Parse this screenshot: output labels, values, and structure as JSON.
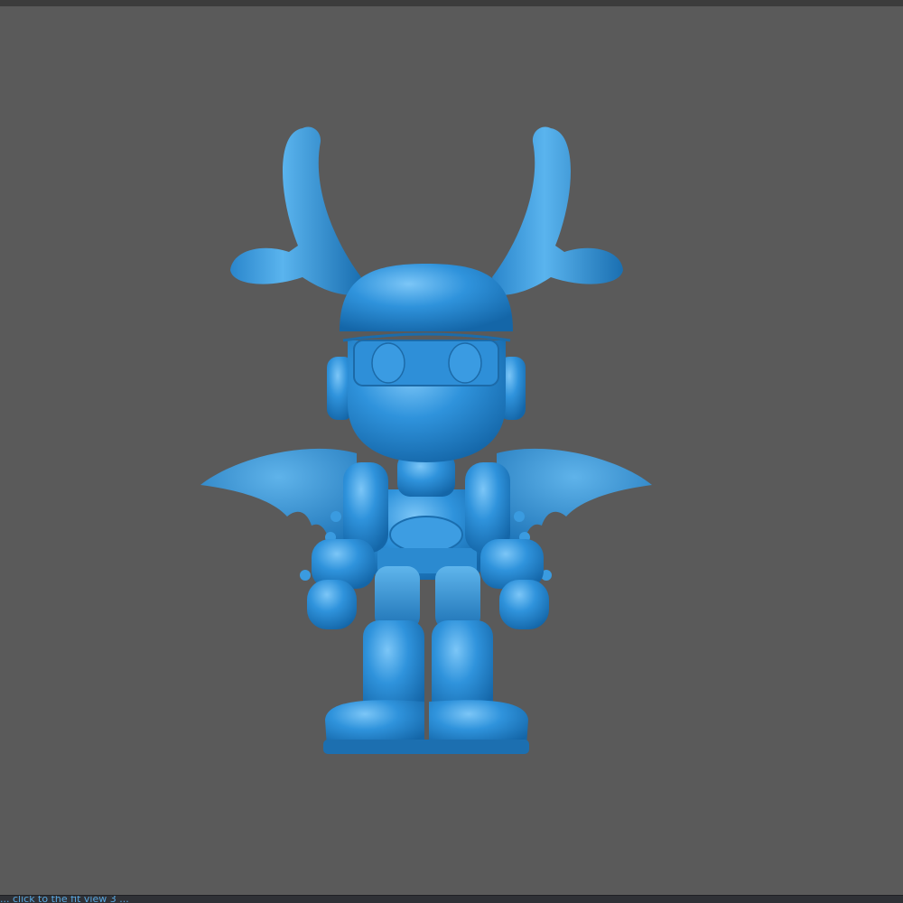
{
  "viewport": {
    "background": "#5a5a5a",
    "model_color": "#2f8fd6",
    "model_name": "blue-demon-robot-figurine"
  },
  "status": {
    "text": "... click to the fit view 3 ..."
  }
}
